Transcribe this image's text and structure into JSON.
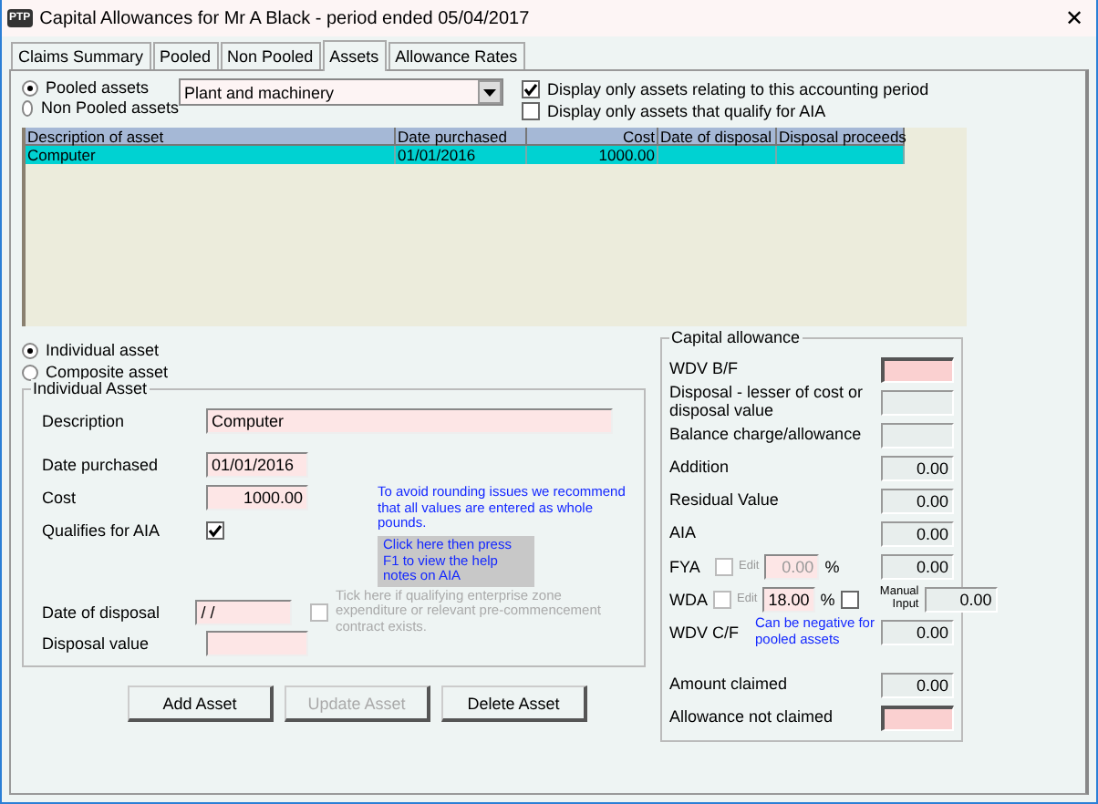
{
  "window": {
    "icon": "PTP",
    "title": "Capital Allowances for Mr A Black -  period ended 05/04/2017",
    "close": "✕"
  },
  "tabs": [
    {
      "label": "Claims Summary",
      "selected": false
    },
    {
      "label": "Pooled",
      "selected": false
    },
    {
      "label": "Non Pooled",
      "selected": false
    },
    {
      "label": "Assets",
      "selected": true
    },
    {
      "label": "Allowance Rates",
      "selected": false
    }
  ],
  "pool_type": [
    {
      "label": "Pooled assets",
      "selected": true
    },
    {
      "label": "Non Pooled assets",
      "selected": false
    }
  ],
  "category": {
    "value": "Plant and machinery"
  },
  "filters": [
    {
      "label": "Display only assets relating to this accounting period",
      "checked": true
    },
    {
      "label": "Display only assets that qualify for AIA",
      "checked": false
    }
  ],
  "table": {
    "columns": [
      {
        "label": "Description of asset"
      },
      {
        "label": "Date purchased"
      },
      {
        "label": "Cost"
      },
      {
        "label": "Date of disposal"
      },
      {
        "label": "Disposal proceeds"
      }
    ],
    "rows": [
      {
        "cells": [
          "Computer",
          "01/01/2016",
          "1000.00",
          null,
          null
        ],
        "selected": true
      }
    ]
  },
  "asset_type": [
    {
      "label": "Individual asset",
      "selected": true
    },
    {
      "label": "Composite asset",
      "selected": false
    }
  ],
  "individual_asset": {
    "title": "Individual Asset",
    "description": {
      "label": "Description",
      "value": "Computer"
    },
    "date_purchased": {
      "label": "Date purchased",
      "value": "01/01/2016"
    },
    "cost": {
      "label": "Cost",
      "value": "1000.00"
    },
    "rounding_note": "To avoid rounding issues we recommend that all values are entered as whole pounds.",
    "help_note": "Click here then press F1 to view the help notes on AIA",
    "qualifies_aia": {
      "label": "Qualifies for AIA",
      "checked": true
    },
    "date_of_disposal": {
      "label": "Date of disposal",
      "value": " /  /"
    },
    "enterprise_zone": {
      "label": "Tick here if qualifying enterprise zone expenditure or relevant pre-commencement contract exists.",
      "checked": false,
      "disabled": true
    },
    "disposal_value": {
      "label": "Disposal value"
    }
  },
  "buttons": [
    {
      "label": "Add Asset",
      "disabled": false
    },
    {
      "label": "Update Asset",
      "disabled": true
    },
    {
      "label": "Delete Asset",
      "disabled": false
    }
  ],
  "capital_allowance": {
    "title": "Capital allowance",
    "rows": [
      {
        "kind": "plain",
        "label": "WDV B/F",
        "editable": true
      },
      {
        "kind": "plain",
        "label": "Disposal - lesser of cost or disposal value",
        "editable": false
      },
      {
        "kind": "plain",
        "label": "Balance charge/allowance",
        "editable": false
      },
      {
        "kind": "plain",
        "label": "Addition",
        "value": "0.00",
        "editable": false
      },
      {
        "kind": "plain",
        "label": "Residual Value",
        "value": "0.00",
        "editable": false
      },
      {
        "kind": "plain",
        "label": "AIA",
        "value": "0.00",
        "editable": false
      },
      {
        "kind": "rate",
        "label": "FYA",
        "edit_label": "Edit",
        "edit_checked": false,
        "rate": "0.00",
        "rate_disabled": true,
        "percent": "%",
        "value": "0.00",
        "editable": false
      },
      {
        "kind": "rate",
        "label": "WDA",
        "edit_label": "Edit",
        "edit_checked": false,
        "rate": "18.00",
        "rate_disabled": false,
        "percent": "%",
        "manual_label": "Manual Input",
        "manual_checked": false,
        "value": "0.00",
        "editable": false
      },
      {
        "kind": "note",
        "label": "WDV C/F",
        "note": "Can be negative for pooled assets",
        "value": "0.00",
        "editable": false
      },
      {
        "kind": "gap"
      },
      {
        "kind": "plain",
        "label": "Amount claimed",
        "value": "0.00",
        "editable": false
      },
      {
        "kind": "plain",
        "label": "Allowance not claimed",
        "editable": true
      }
    ]
  }
}
